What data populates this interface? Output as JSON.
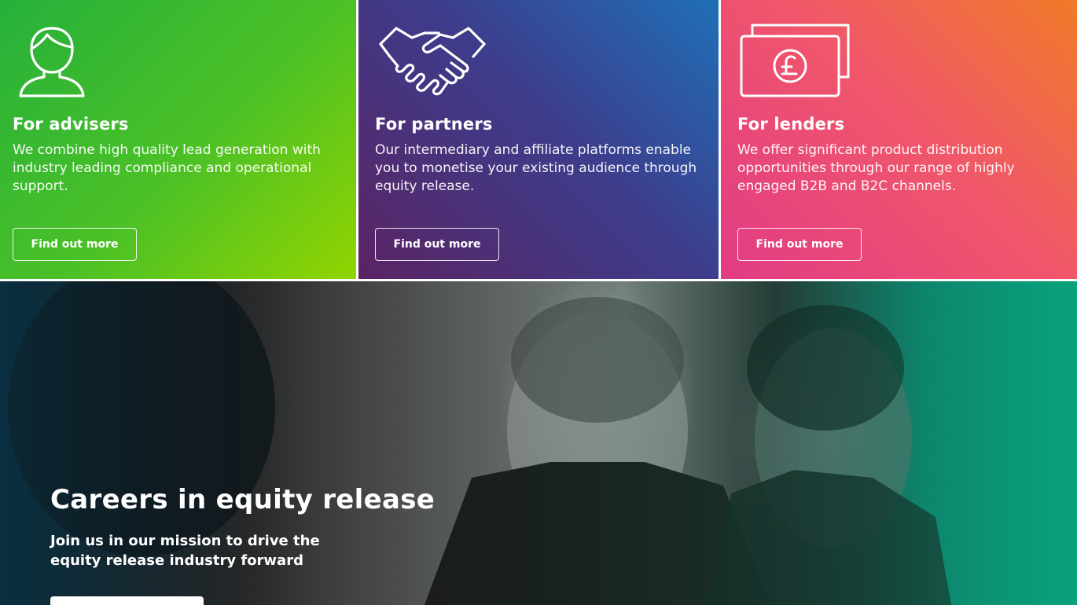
{
  "cards": [
    {
      "icon": "person-icon",
      "title": "For advisers",
      "text": "We combine high quality lead generation with industry leading compliance and operational support.",
      "button": "Find out more"
    },
    {
      "icon": "handshake-icon",
      "title": "For partners",
      "text": "Our intermediary and affiliate platforms enable you to monetise your existing audience through equity release.",
      "button": "Find out more"
    },
    {
      "icon": "banknote-pound-icon",
      "title": "For lenders",
      "text": "We offer significant product distribution opportunities through our range of highly engaged B2B and B2C channels.",
      "button": "Find out more"
    }
  ],
  "hero": {
    "title": "Careers in equity release",
    "subtitle": "Join us in our mission to drive the equity release industry forward"
  },
  "colors": {
    "advisers": "#4cc126",
    "partners": "#3d3d8c",
    "lenders": "#f0576a",
    "hero_accent": "#0aa37e"
  }
}
